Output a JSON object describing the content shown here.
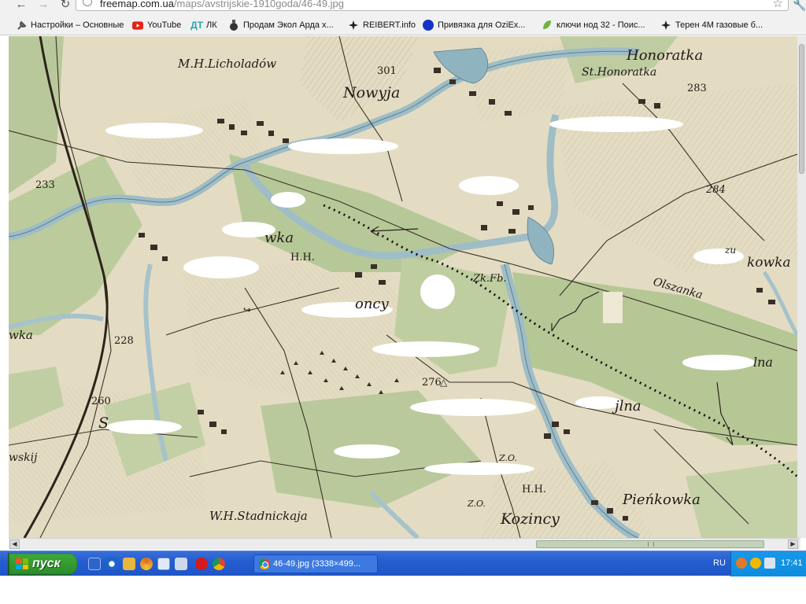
{
  "browser": {
    "url_host": "freemap.com.ua",
    "url_path": "/maps/avstrijskie-1910goda/46-49.jpg",
    "bookmarks": [
      {
        "label": "Настройки – Основные",
        "icon": "wrench-icon"
      },
      {
        "label": "YouTube",
        "icon": "youtube-icon"
      },
      {
        "label": "ЛК",
        "icon": "dt-logo-icon"
      },
      {
        "label": "Продам Экол Арда х...",
        "icon": "grenade-icon"
      },
      {
        "label": "REIBERT.info",
        "icon": "cross-icon"
      },
      {
        "label": "Привязка для OziEx...",
        "icon": "blue-circle-icon"
      },
      {
        "label": "ключи нод 32 - Поис...",
        "icon": "leaf-icon"
      },
      {
        "label": "Терен 4М газовые б...",
        "icon": "cross-icon"
      }
    ]
  },
  "map": {
    "labels": [
      "M.H.Licholadów",
      "301",
      "Nowyja",
      "Honoratka",
      "St.Honoratka",
      "283",
      "233",
      "284",
      "wka",
      "H.H.",
      "Zk.Fb.",
      "Olszanka",
      "kowka",
      "zu",
      "228",
      "276",
      "260",
      "jlna",
      "Z.O.",
      "H.H.",
      "Z.O.",
      "Kozincy",
      "Pieńkowka",
      "W.H.Stadnickaja",
      "wskij",
      "wka",
      "S",
      "oncy",
      "lna"
    ]
  },
  "taskbar": {
    "start_label": "пуск",
    "task_label": "46-49.jpg (3338×499...",
    "language": "RU",
    "clock": "17:41"
  }
}
